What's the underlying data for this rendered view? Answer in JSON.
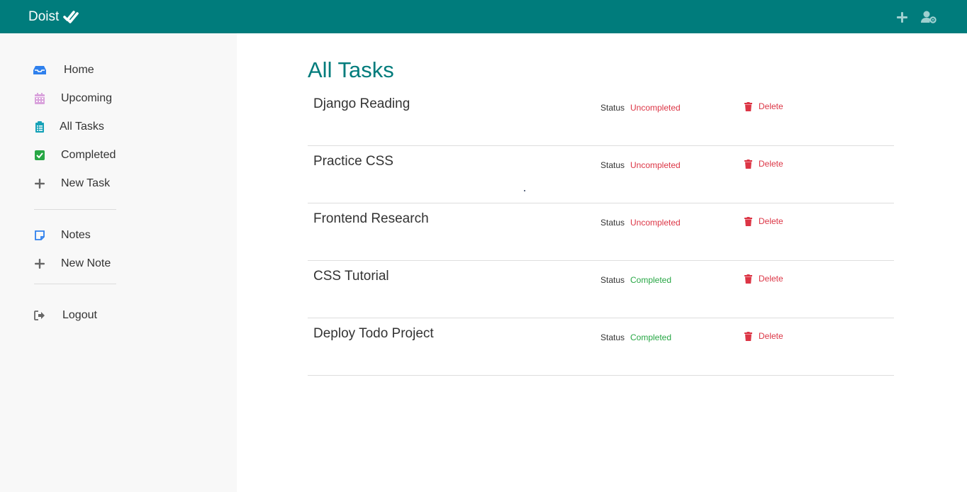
{
  "header": {
    "brand": "Doist",
    "brand_icon": "double-check-icon",
    "add_icon": "plus-icon",
    "profile_icon": "user-cog-icon"
  },
  "sidebar": {
    "items": [
      {
        "label": "Home",
        "icon": "inbox-icon",
        "color": "#2f80ed"
      },
      {
        "label": "Upcoming",
        "icon": "calendar-icon",
        "color": "#d9a3dc"
      },
      {
        "label": "All Tasks",
        "icon": "clipboard-list-icon",
        "color": "#17a2b8"
      },
      {
        "label": "Completed",
        "icon": "check-square-icon",
        "color": "#28a745"
      },
      {
        "label": "New Task",
        "icon": "plus-icon",
        "color": "#666666"
      }
    ],
    "notes_items": [
      {
        "label": "Notes",
        "icon": "sticky-note-icon",
        "color": "#2f80ed"
      },
      {
        "label": "New Note",
        "icon": "plus-icon",
        "color": "#666666"
      }
    ],
    "logout": {
      "label": "Logout",
      "icon": "sign-out-icon",
      "color": "#666666"
    }
  },
  "main": {
    "title": "All Tasks",
    "status_label": "Status",
    "delete_label": "Delete",
    "tasks": [
      {
        "name": "Django Reading",
        "status": "Uncompleted"
      },
      {
        "name": "Practice CSS",
        "status": "Uncompleted"
      },
      {
        "name": "Frontend Research",
        "status": "Uncompleted"
      },
      {
        "name": "CSS Tutorial",
        "status": "Completed"
      },
      {
        "name": "Deploy Todo Project",
        "status": "Completed"
      }
    ]
  },
  "colors": {
    "header_bg": "#007c7c",
    "title": "#007c7c",
    "uncompleted": "#dc3545",
    "completed": "#28a745",
    "delete": "#dc3545"
  }
}
